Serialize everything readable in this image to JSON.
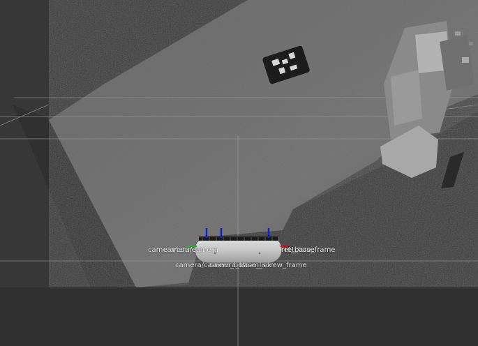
{
  "viewport": {
    "background": "#303030",
    "floor_color": "#3a3a3a",
    "grid_color": "#9a9a9a",
    "platform_color": "#777777",
    "robot_body_color": "#c9c9c9",
    "axis_colors": {
      "x": "#d01010",
      "y": "#10c010",
      "z": "#1020d0"
    }
  },
  "frame_labels": {
    "left": "camera/camera",
    "left_overlap": "camera/camera",
    "right": "ret_base_frame",
    "right_overlap": "ret_base",
    "bottom": "camera/camera_bottom_screw_frame",
    "bottom_overlap": "camera_base_link"
  },
  "objects": {
    "marker": "aruco-marker",
    "robot": "robot-base"
  }
}
